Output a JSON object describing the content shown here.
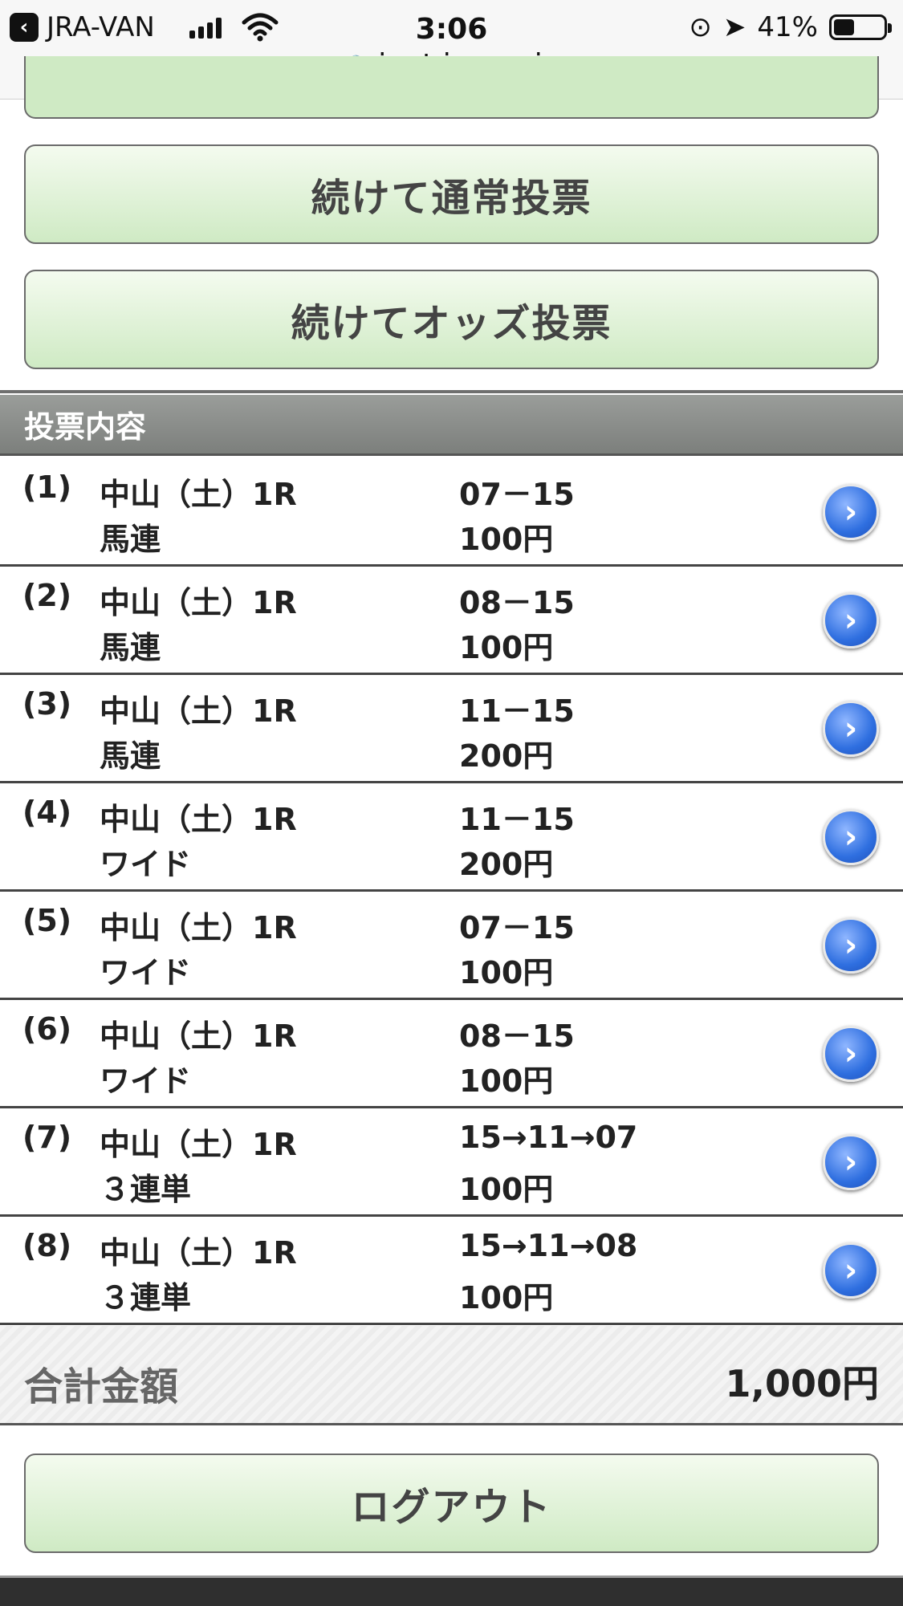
{
  "statusbar": {
    "back_app": "JRA-VAN",
    "time": "3:06",
    "battery": "41%",
    "battery_level": 0.41,
    "url": "ipat.jra.go.jp"
  },
  "buttons": {
    "continue_normal": "続けて通常投票",
    "continue_odds": "続けてオッズ投票",
    "logout": "ログアウト"
  },
  "section": {
    "title": "投票内容"
  },
  "bets": [
    {
      "num": "(1)",
      "race": "中山（土）1R",
      "type": "馬連",
      "combo": "07－15",
      "amount": "100円"
    },
    {
      "num": "(2)",
      "race": "中山（土）1R",
      "type": "馬連",
      "combo": "08－15",
      "amount": "100円"
    },
    {
      "num": "(3)",
      "race": "中山（土）1R",
      "type": "馬連",
      "combo": "11－15",
      "amount": "200円"
    },
    {
      "num": "(4)",
      "race": "中山（土）1R",
      "type": "ワイド",
      "combo": "11－15",
      "amount": "200円"
    },
    {
      "num": "(5)",
      "race": "中山（土）1R",
      "type": "ワイド",
      "combo": "07－15",
      "amount": "100円"
    },
    {
      "num": "(6)",
      "race": "中山（土）1R",
      "type": "ワイド",
      "combo": "08－15",
      "amount": "100円"
    },
    {
      "num": "(7)",
      "race": "中山（土）1R",
      "type": "３連単",
      "combo": "15→11→07",
      "amount": "100円"
    },
    {
      "num": "(8)",
      "race": "中山（土）1R",
      "type": "３連単",
      "combo": "15→11→08",
      "amount": "100円"
    }
  ],
  "total": {
    "label": "合計金額",
    "value": "1,000円"
  }
}
